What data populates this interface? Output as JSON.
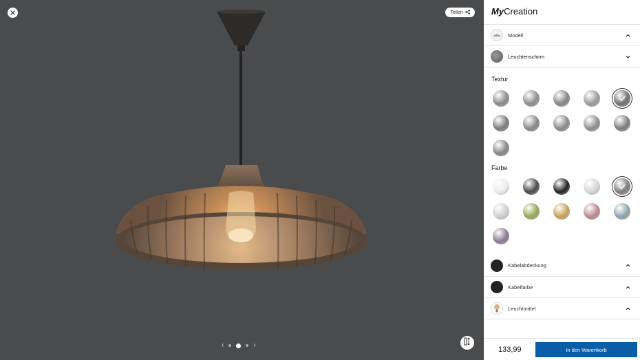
{
  "viewer": {
    "share_label": "Teilen",
    "pagination": {
      "prev": "‹",
      "next": "›",
      "pages": 3,
      "current": 2
    }
  },
  "brand": {
    "bold": "My",
    "rest": "Creation"
  },
  "sections": {
    "modell": {
      "label": "Modell",
      "chevron": "up"
    },
    "leuchtenschirm": {
      "label": "Leuchtenschirm",
      "chevron": "down"
    },
    "kabelabdeckung": {
      "label": "Kabelabdeckung",
      "chevron": "up"
    },
    "kabelfarbe": {
      "label": "Kabelfarbe",
      "chevron": "up"
    },
    "leuchtmittel": {
      "label": "Leuchtmittel",
      "chevron": "up"
    }
  },
  "textur": {
    "title": "Textur",
    "options": [
      {
        "name": "texture-horizontal-ribs",
        "color": "#8a8a8a",
        "selected": false
      },
      {
        "name": "texture-fine-lines",
        "color": "#8e8e8e",
        "selected": false
      },
      {
        "name": "texture-wave",
        "color": "#858585",
        "selected": false
      },
      {
        "name": "texture-gradient",
        "color": "#9a9a9a",
        "selected": false
      },
      {
        "name": "texture-smooth-dark",
        "color": "#707070",
        "selected": true
      },
      {
        "name": "texture-vertical-ribs",
        "color": "#7b7b7b",
        "selected": false
      },
      {
        "name": "texture-diagonal",
        "color": "#888888",
        "selected": false
      },
      {
        "name": "texture-twist",
        "color": "#8a8a8a",
        "selected": false
      },
      {
        "name": "texture-curved-lines",
        "color": "#8f8f8f",
        "selected": false
      },
      {
        "name": "texture-plain",
        "color": "#7c7c7c",
        "selected": false
      },
      {
        "name": "texture-coarse-lines",
        "color": "#868686",
        "selected": false
      }
    ]
  },
  "farbe": {
    "title": "Farbe",
    "options": [
      {
        "name": "color-white",
        "color": "#ececec",
        "selected": false
      },
      {
        "name": "color-dark-grey-metallic",
        "color": "#4a4a4a",
        "selected": false
      },
      {
        "name": "color-black",
        "color": "#232323",
        "selected": false
      },
      {
        "name": "color-silver-light",
        "color": "#d6d6d6",
        "selected": false
      },
      {
        "name": "color-grey",
        "color": "#7d7d7d",
        "selected": true
      },
      {
        "name": "color-light-silver",
        "color": "#cfcfcf",
        "selected": false
      },
      {
        "name": "color-olive-green",
        "color": "#95a957",
        "selected": false
      },
      {
        "name": "color-gold",
        "color": "#c8a25a",
        "selected": false
      },
      {
        "name": "color-rose",
        "color": "#b98a8e",
        "selected": false
      },
      {
        "name": "color-blue-grey",
        "color": "#8ea3ad",
        "selected": false
      },
      {
        "name": "color-lavender",
        "color": "#8c7b93",
        "selected": false
      }
    ]
  },
  "footer": {
    "price": "133,99",
    "cart_label": "In den Warenkorb"
  },
  "colors": {
    "viewer_bg": "#4a4b4d",
    "accent": "#0a5ea7"
  }
}
